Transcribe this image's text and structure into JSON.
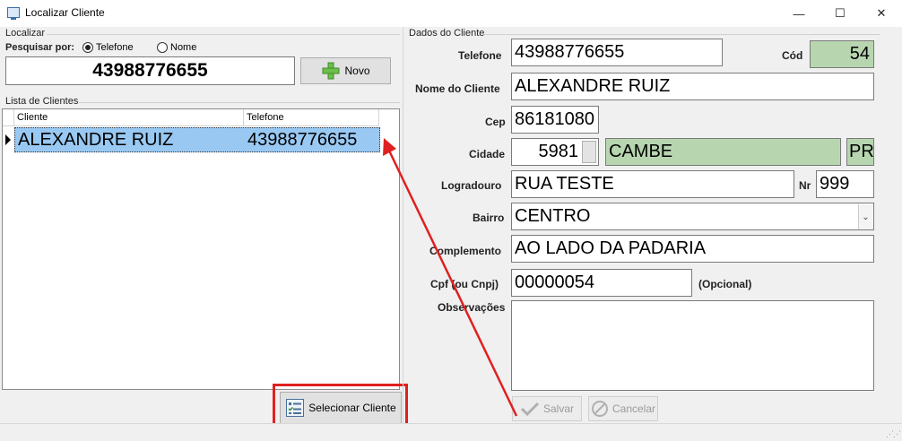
{
  "window": {
    "title": "Localizar Cliente",
    "minimize_glyph": "—",
    "maximize_glyph": "☐",
    "close_glyph": "✕"
  },
  "localizar": {
    "group_label": "Localizar",
    "pesquisar_label": "Pesquisar por:",
    "radio_telefone": "Telefone",
    "radio_nome": "Nome",
    "search_value": "43988776655",
    "novo_label": "Novo"
  },
  "lista": {
    "group_label": "Lista de Clientes",
    "columns": [
      "Cliente",
      "Telefone"
    ],
    "rows": [
      {
        "cliente": "ALEXANDRE RUIZ",
        "telefone": "43988776655"
      }
    ],
    "selecionar_label": "Selecionar Cliente"
  },
  "dados": {
    "group_label": "Dados do Cliente",
    "telefone_label": "Telefone",
    "telefone_value": "43988776655",
    "cod_label": "Cód",
    "cod_value": "54",
    "nome_label": "Nome do Cliente",
    "nome_value": "ALEXANDRE RUIZ",
    "cep_label": "Cep",
    "cep_value": "86181080",
    "cidade_label": "Cidade",
    "cidade_code": "5981",
    "cidade_name": "CAMBE",
    "uf_value": "PR",
    "logradouro_label": "Logradouro",
    "logradouro_value": "RUA TESTE",
    "nr_label": "Nr",
    "nr_value": "999",
    "bairro_label": "Bairro",
    "bairro_value": "CENTRO",
    "complemento_label": "Complemento",
    "complemento_value": "AO LADO DA PADARIA",
    "cpf_label": "Cpf (ou Cnpj)",
    "cpf_value": "00000054",
    "opcional_label": "(Opcional)",
    "observacoes_label": "Observações",
    "observacoes_value": "",
    "salvar_label": "Salvar",
    "cancelar_label": "Cancelar"
  },
  "annotation": {
    "color": "#e02020"
  }
}
